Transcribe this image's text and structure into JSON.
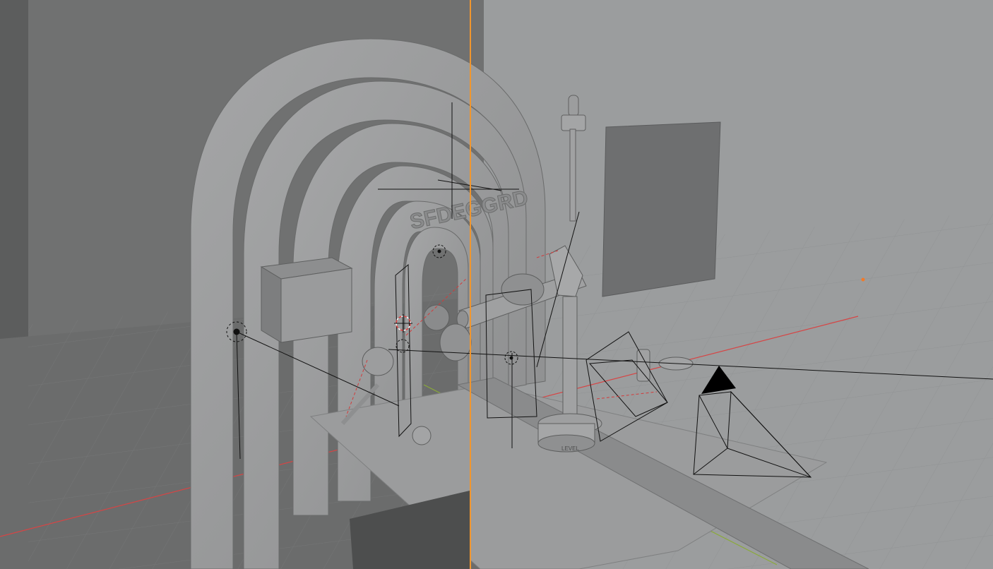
{
  "viewport": {
    "text_mesh_label": "SFDEGGRD",
    "pedestal_label": "LEVEL"
  },
  "colors": {
    "background": "#9a9c9d",
    "back_wall": "#6f7070",
    "object_gray": "#a3a3a3",
    "x_axis": "#d64545",
    "y_axis": "#8aaa3a",
    "active_divider": "#f0962e",
    "wire": "#111111",
    "cursor": "#e04040"
  },
  "icons": {
    "light": "sun-light-icon",
    "camera": "camera-icon",
    "cursor": "3d-cursor-icon"
  }
}
